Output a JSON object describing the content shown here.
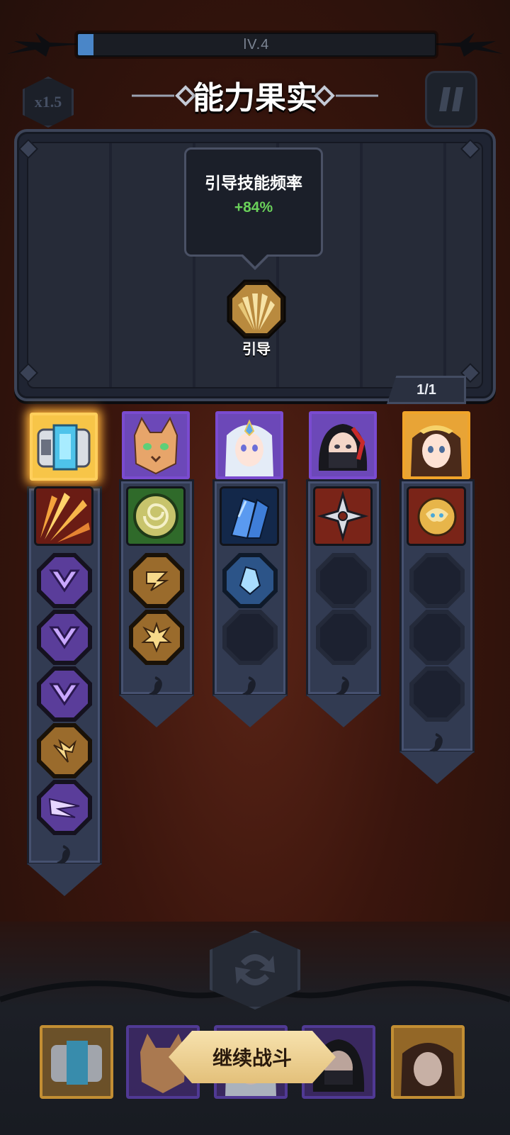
{
  "hud": {
    "level_text": "lV.4",
    "speed_label": "x1.5",
    "title": "能力果实",
    "pause_icon": "pause-icon"
  },
  "panel": {
    "tooltip_title": "引导技能频率",
    "tooltip_value": "+84%",
    "selected_skill_label": "引导",
    "pager": "1/1"
  },
  "colors": {
    "accent_gold": "#e3c07a",
    "bonus_green": "#6ad15a",
    "rare_purple": "#7a4bd0",
    "legend_gold": "#f0a42a"
  },
  "heroes": [
    {
      "name_icon": "mech-chest-hero",
      "rarity": "gold-glow",
      "skill_icon": "flame-burst-icon",
      "slots": [
        "purple-arrow-icon",
        "purple-arrow-icon",
        "purple-arrow-icon",
        "lightning-coin-icon",
        "purple-slash-icon"
      ]
    },
    {
      "name_icon": "lynx-hero",
      "rarity": "purple",
      "skill_icon": "vortex-rune-icon",
      "slots": [
        "spiral-coin-icon",
        "explosion-coin-icon"
      ]
    },
    {
      "name_icon": "ice-priestess-hero",
      "rarity": "purple",
      "skill_icon": "ice-crystal-icon",
      "slots": [
        "ice-shard-coin-icon",
        "empty"
      ]
    },
    {
      "name_icon": "ninja-girl-hero",
      "rarity": "purple",
      "skill_icon": "shuriken-icon",
      "slots": [
        "empty",
        "empty"
      ]
    },
    {
      "name_icon": "golden-queen-hero",
      "rarity": "gold",
      "skill_icon": "golden-orb-icon",
      "slots": [
        "empty",
        "empty",
        "empty"
      ]
    }
  ],
  "bottom": {
    "continue_label": "继续战斗",
    "refresh_icon": "refresh-icon"
  }
}
